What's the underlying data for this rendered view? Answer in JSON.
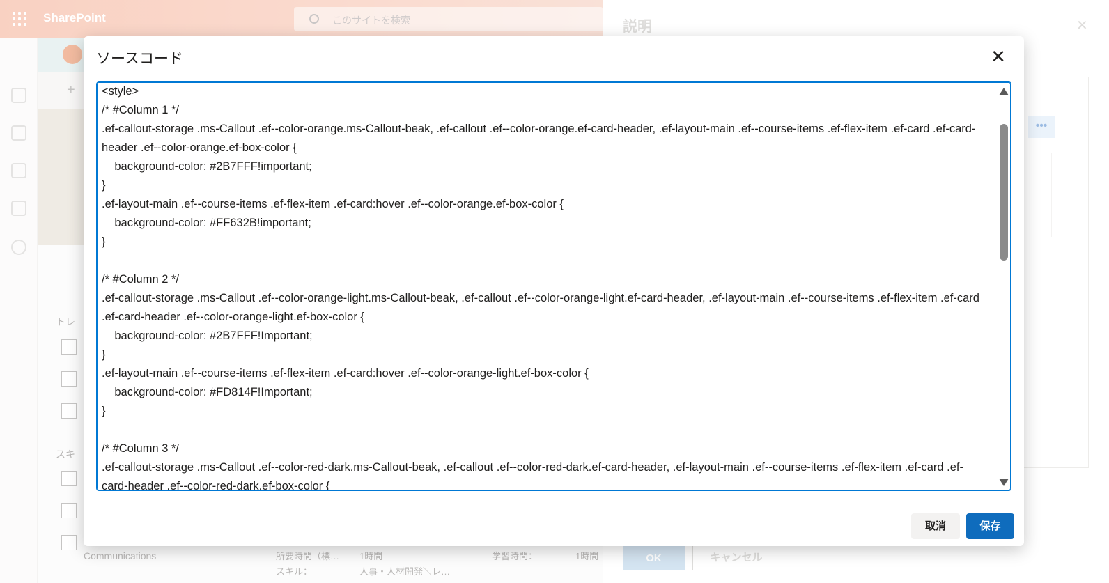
{
  "suitebar": {
    "brand": "SharePoint",
    "search_placeholder": "このサイトを検索"
  },
  "background": {
    "section_1": "トレ",
    "section_2": "スキ",
    "communications": "Communications",
    "row_1_label": "所要時間（標…",
    "row_1_value": "1時間",
    "row_2_label": "スキル：",
    "row_2_value": "人事・人材開発＼レ…",
    "row_3_label": "学習時間：",
    "row_3_value": "1時間"
  },
  "panel": {
    "title": "説明",
    "ok_label": "OK",
    "cancel_label": "キャンセル",
    "more_label": "•••"
  },
  "modal": {
    "title": "ソースコード",
    "close_glyph": "✕",
    "cancel_label": "取消",
    "save_label": "保存",
    "code_lines": [
      "<style>",
      "/* #Column 1 */",
      ".ef-callout-storage .ms-Callout .ef--color-orange.ms-Callout-beak, .ef-callout .ef--color-orange.ef-card-header, .ef-layout-main .ef--course-items .ef-flex-item .ef-card .ef-card-header .ef--color-orange.ef-box-color {",
      "    background-color: #2B7FFF!important;",
      "}",
      ".ef-layout-main .ef--course-items .ef-flex-item .ef-card:hover .ef--color-orange.ef-box-color {",
      "    background-color: #FF632B!important;",
      "}",
      "",
      "/* #Column 2 */",
      ".ef-callout-storage .ms-Callout .ef--color-orange-light.ms-Callout-beak, .ef-callout .ef--color-orange-light.ef-card-header, .ef-layout-main .ef--course-items .ef-flex-item .ef-card .ef-card-header .ef--color-orange-light.ef-box-color {",
      "    background-color: #2B7FFF!Important;",
      "}",
      ".ef-layout-main .ef--course-items .ef-flex-item .ef-card:hover .ef--color-orange-light.ef-box-color {",
      "    background-color: #FD814F!Important;",
      "}",
      "",
      "/* #Column 3 */",
      ".ef-callout-storage .ms-Callout .ef--color-red-dark.ms-Callout-beak, .ef-callout .ef--color-red-dark.ef-card-header, .ef-layout-main .ef--course-items .ef-flex-item .ef-card .ef-card-header .ef--color-red-dark.ef-box-color {"
    ]
  },
  "colors": {
    "accent": "#0f6cbd",
    "suitebar": "#f6b39a"
  }
}
